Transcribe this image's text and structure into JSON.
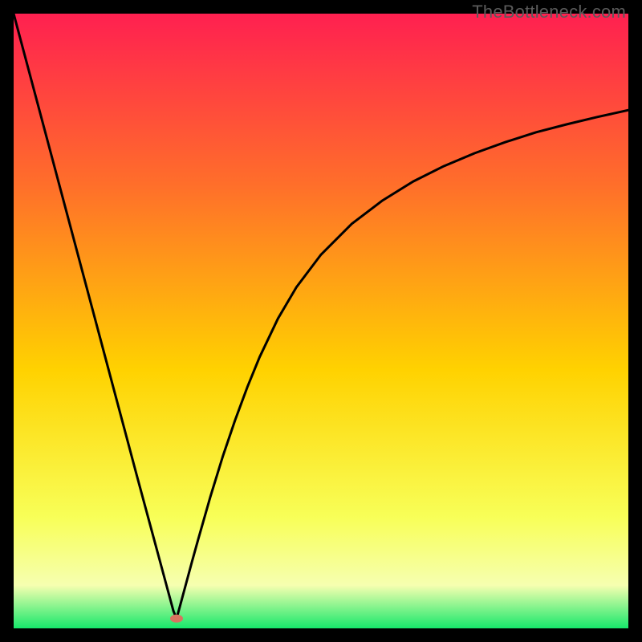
{
  "watermark": "TheBottleneck.com",
  "chart_data": {
    "type": "line",
    "title": "",
    "xlabel": "",
    "ylabel": "",
    "xlim": [
      0,
      100
    ],
    "ylim": [
      0,
      100
    ],
    "grid": false,
    "legend": false,
    "background_gradient": {
      "top": "#ff2050",
      "mid_upper": "#ff6f2a",
      "mid": "#ffd200",
      "mid_lower": "#f8ff58",
      "band": "#f6ffb0",
      "bottom": "#17e86b"
    },
    "notch_marker": {
      "x": 26.5,
      "y": 1.6,
      "color": "#d8735f"
    },
    "series": [
      {
        "name": "left-branch",
        "x": [
          0,
          2,
          4,
          6,
          8,
          10,
          12,
          14,
          16,
          18,
          20,
          22,
          24,
          25,
          26,
          26.5
        ],
        "y": [
          100,
          92.5,
          85,
          77.5,
          70,
          62.5,
          55,
          47.5,
          40,
          32.5,
          25.0,
          17.6,
          10.2,
          6.5,
          2.8,
          1.6
        ]
      },
      {
        "name": "right-branch",
        "x": [
          26.5,
          27,
          28,
          29,
          30,
          32,
          34,
          36,
          38,
          40,
          43,
          46,
          50,
          55,
          60,
          65,
          70,
          75,
          80,
          85,
          90,
          95,
          100
        ],
        "y": [
          1.6,
          3.4,
          7.1,
          10.8,
          14.4,
          21.4,
          27.9,
          33.8,
          39.2,
          44.1,
          50.4,
          55.5,
          60.8,
          65.8,
          69.6,
          72.7,
          75.2,
          77.3,
          79.1,
          80.7,
          82.0,
          83.2,
          84.3
        ]
      }
    ]
  }
}
